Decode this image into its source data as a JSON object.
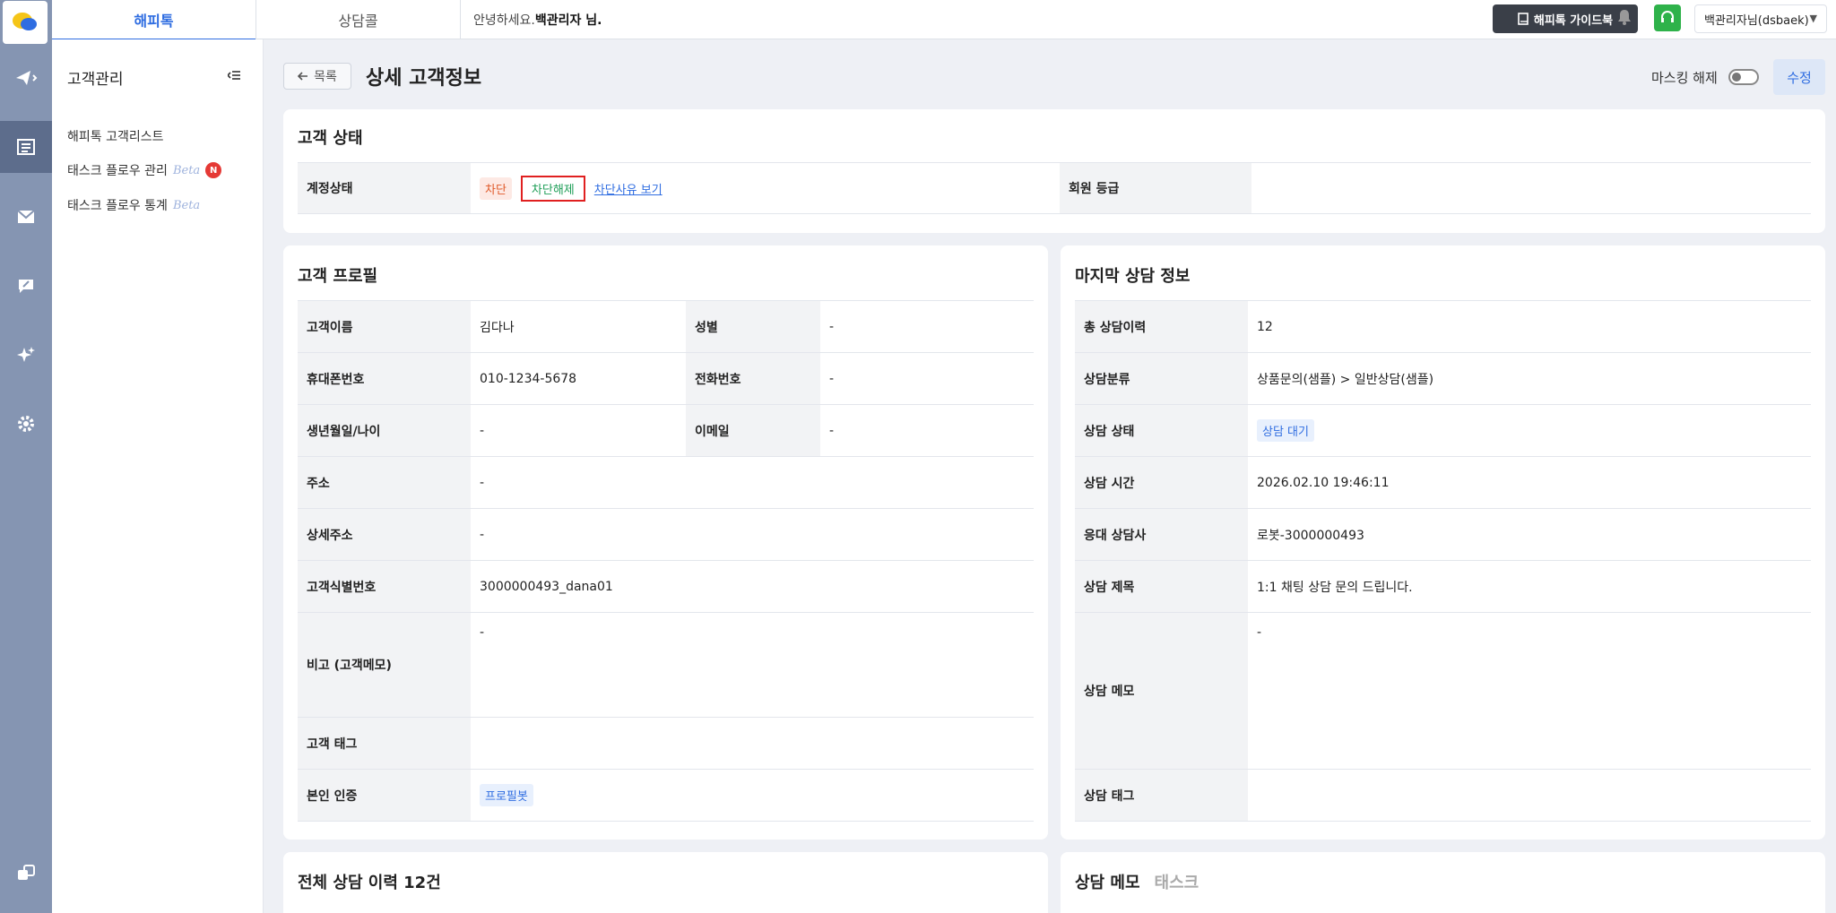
{
  "topbar": {
    "tabs": [
      "해피톡",
      "상담콜"
    ],
    "greeting_prefix": "안녕하세요.",
    "greeting_name": "백관리자 님.",
    "guide_label": "해피톡 가이드북",
    "user_label": "백관리자님(dsbaek)"
  },
  "subnav": {
    "title": "고객관리",
    "items": [
      {
        "label": "해피톡 고객리스트"
      },
      {
        "label": "태스크 플로우 관리",
        "beta": "Beta",
        "badge": "N"
      },
      {
        "label": "태스크 플로우 통계",
        "beta": "Beta"
      }
    ]
  },
  "header": {
    "back_label": "목록",
    "title": "상세 고객정보",
    "mask_label": "마스킹 해제",
    "edit_label": "수정"
  },
  "status_card": {
    "title": "고객 상태",
    "account_label": "계정상태",
    "block_tag": "차단",
    "unblock_tag": "차단해제",
    "reason_link": "차단사유 보기",
    "grade_label": "회원 등급"
  },
  "profile": {
    "title": "고객 프로필",
    "name_label": "고객이름",
    "name": "김다나",
    "gender_label": "성별",
    "gender": "-",
    "mobile_label": "휴대폰번호",
    "mobile": "010-1234-5678",
    "phone_label": "전화번호",
    "phone": "-",
    "birth_label": "생년월일/나이",
    "birth": "-",
    "email_label": "이메일",
    "email": "-",
    "address_label": "주소",
    "address": "-",
    "detail_address_label": "상세주소",
    "detail_address": "-",
    "customer_id_label": "고객식별번호",
    "customer_id": "3000000493_dana01",
    "memo_label": "비고 (고객메모)",
    "memo": "-",
    "tag_label": "고객 태그",
    "auth_label": "본인 인증",
    "auth_chip": "프로필봇"
  },
  "last_consult": {
    "title": "마지막 상담 정보",
    "total_label": "총 상담이력",
    "total": "12",
    "category_label": "상담분류",
    "category": "상품문의(샘플) > 일반상담(샘플)",
    "status_label": "상담 상태",
    "status_chip": "상담 대기",
    "time_label": "상담 시간",
    "time": "2026.02.10 19:46:11",
    "agent_label": "응대 상담사",
    "agent": "로봇-3000000493",
    "subject_label": "상담 제목",
    "subject": "1:1 채팅 상담 문의 드립니다.",
    "memo_label": "상담 메모",
    "memo": "-",
    "tag_label": "상담 태그"
  },
  "history": {
    "title": "전체 상담 이력 12건"
  },
  "memo_tabs": {
    "active": "상담 메모",
    "inactive": "태스크"
  }
}
